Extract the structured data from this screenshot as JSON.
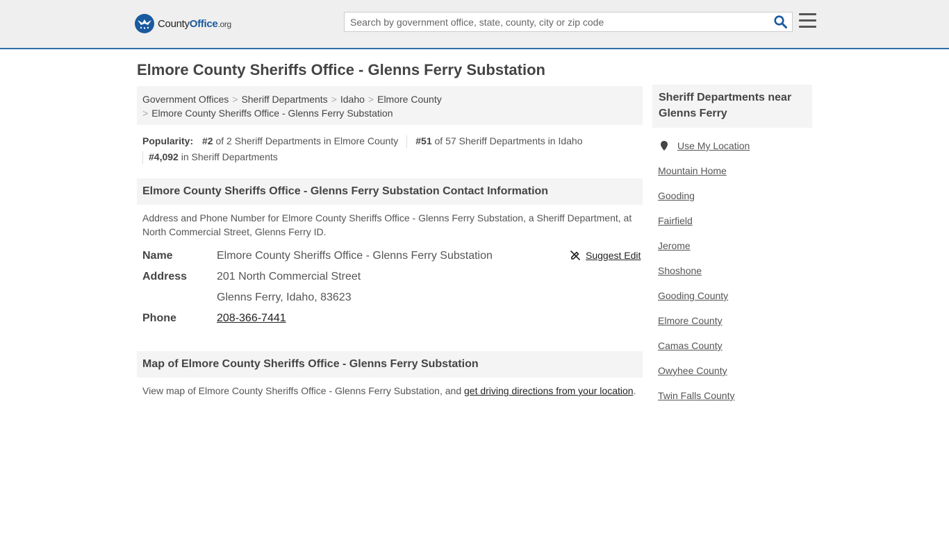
{
  "brand": {
    "name_prefix": "County",
    "name_highlight": "Office",
    "name_suffix": ".org"
  },
  "search": {
    "placeholder": "Search by government office, state, county, city or zip code",
    "value": ""
  },
  "page_title": "Elmore County Sheriffs Office - Glenns Ferry Substation",
  "breadcrumb": [
    {
      "label": "Government Offices"
    },
    {
      "label": "Sheriff Departments"
    },
    {
      "label": "Idaho"
    },
    {
      "label": "Elmore County"
    },
    {
      "label": "Elmore County Sheriffs Office - Glenns Ferry Substation"
    }
  ],
  "popularity": {
    "label": "Popularity:",
    "items": [
      {
        "rank": "#2",
        "text": "of 2 Sheriff Departments in Elmore County"
      },
      {
        "rank": "#51",
        "text": "of 57 Sheriff Departments in Idaho"
      },
      {
        "rank": "#4,092",
        "text": "in Sheriff Departments"
      }
    ]
  },
  "contact": {
    "heading": "Elmore County Sheriffs Office - Glenns Ferry Substation Contact Information",
    "description": "Address and Phone Number for Elmore County Sheriffs Office - Glenns Ferry Substation, a Sheriff Department, at North Commercial Street, Glenns Ferry ID.",
    "suggest_edit": "Suggest Edit",
    "name_label": "Name",
    "name_value": "Elmore County Sheriffs Office - Glenns Ferry Substation",
    "address_label": "Address",
    "address_line1": "201 North Commercial Street",
    "address_line2": "Glenns Ferry, Idaho, 83623",
    "phone_label": "Phone",
    "phone_value": "208-366-7441"
  },
  "map": {
    "heading": "Map of Elmore County Sheriffs Office - Glenns Ferry Substation",
    "text_before": "View map of Elmore County Sheriffs Office - Glenns Ferry Substation, and ",
    "link_text": "get driving directions from your location",
    "text_after": "."
  },
  "sidebar": {
    "heading": "Sheriff Departments near Glenns Ferry",
    "use_location": "Use My Location",
    "links": [
      "Mountain Home",
      "Gooding",
      "Fairfield",
      "Jerome",
      "Shoshone",
      "Gooding County",
      "Elmore County",
      "Camas County",
      "Owyhee County",
      "Twin Falls County"
    ]
  },
  "icons": {
    "logo": "eagle-logo-icon",
    "search": "search-icon",
    "menu": "hamburger-menu-icon",
    "suggest": "edit-off-icon",
    "location": "map-pin-icon"
  },
  "colors": {
    "brand_blue": "#1a5a9e",
    "header_border": "#2e6ea8",
    "header_bg": "#efefef",
    "panel_bg": "#f4f4f4"
  }
}
